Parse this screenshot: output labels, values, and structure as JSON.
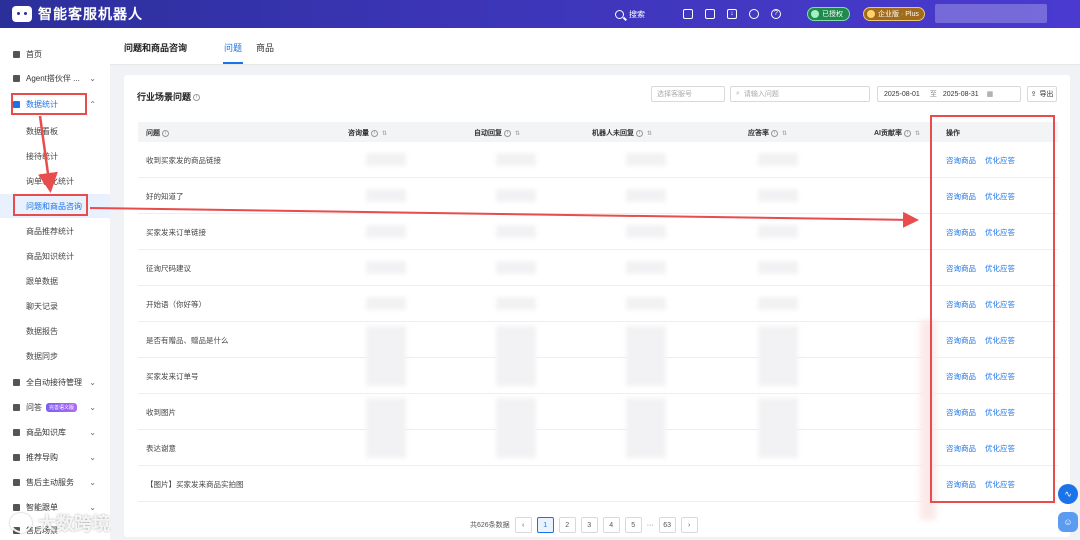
{
  "brand": {
    "name": "智能客服机器人"
  },
  "topbar": {
    "search_label": "搜索",
    "authorized_label": "已授权",
    "plan_label": "企业版 · Plus"
  },
  "sidebar": {
    "items": [
      {
        "label": "首页"
      },
      {
        "label": "Agent搭伙伴 ..."
      },
      {
        "label": "数据统计"
      },
      {
        "label": "全自动接待管理"
      },
      {
        "label": "问答",
        "tag": "完善语义版"
      },
      {
        "label": "商品知识库"
      },
      {
        "label": "推荐导购"
      },
      {
        "label": "售后主动服务"
      },
      {
        "label": "智能跟单"
      },
      {
        "label": "售后场景"
      }
    ],
    "sub_items": [
      "数据看板",
      "接待统计",
      "询单转化统计",
      "问题和商品咨询",
      "商品推荐统计",
      "商品知识统计",
      "跟单数据",
      "聊天记录",
      "数据报告",
      "数据同步"
    ]
  },
  "subheader": {
    "title": "问题和商品咨询",
    "tabs": [
      "问题",
      "商品"
    ]
  },
  "card": {
    "title": "行业场景问题",
    "select_placeholder": "选择客服号",
    "search_placeholder": "请输入问题",
    "date_start": "2025-08-01",
    "date_sep": "至",
    "date_end": "2025-08-31",
    "export_label": "导出"
  },
  "table": {
    "columns": [
      "问题",
      "咨询量",
      "自动回复",
      "机器人未回复",
      "应答率",
      "AI贡献率",
      "操作"
    ],
    "rows": [
      "收到买家发的商品链接",
      "好的知道了",
      "买家发来订单链接",
      "征询尺码建议",
      "开始语（你好等）",
      "是否有赠品、赠品是什么",
      "买家发来订单号",
      "收到图片",
      "表达谢意",
      "【图片】买家发来商品实拍图"
    ],
    "action_consult": "咨询商品",
    "action_optimize": "优化应答"
  },
  "pagination": {
    "total_label": "共626条数据",
    "pages": [
      "1",
      "2",
      "3",
      "4",
      "5",
      "···",
      "63"
    ],
    "current": "1"
  },
  "watermark": {
    "text": "大数跨境"
  }
}
